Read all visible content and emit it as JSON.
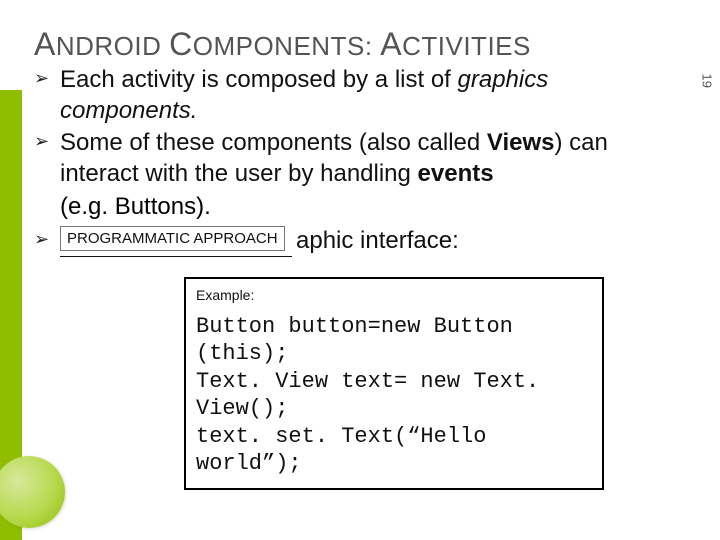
{
  "title_parts": {
    "a1": "A",
    "a2": "NDROID ",
    "b1": "C",
    "b2": "OMPONENTS",
    "sep": ": ",
    "c1": "A",
    "c2": "CTIVITIES"
  },
  "bullets": {
    "b1_a": "Each activity is composed by a list of ",
    "b1_b": "graphics components",
    "b1_c": ".",
    "b2_a": "Some of these components (also called ",
    "b2_b": "Views",
    "b2_c": ") can interact with the user by handling ",
    "b2_d": "events",
    "sub2": "(e.g. Buttons).",
    "b3_tail": "aphic interface:"
  },
  "badge": "PROGRAMMATIC APPROACH",
  "example": {
    "label": "Example:",
    "code": "Button button=new Button (this);\nText. View text= new Text. View();\ntext. set. Text(“Hello world”);"
  },
  "page_number": "19"
}
